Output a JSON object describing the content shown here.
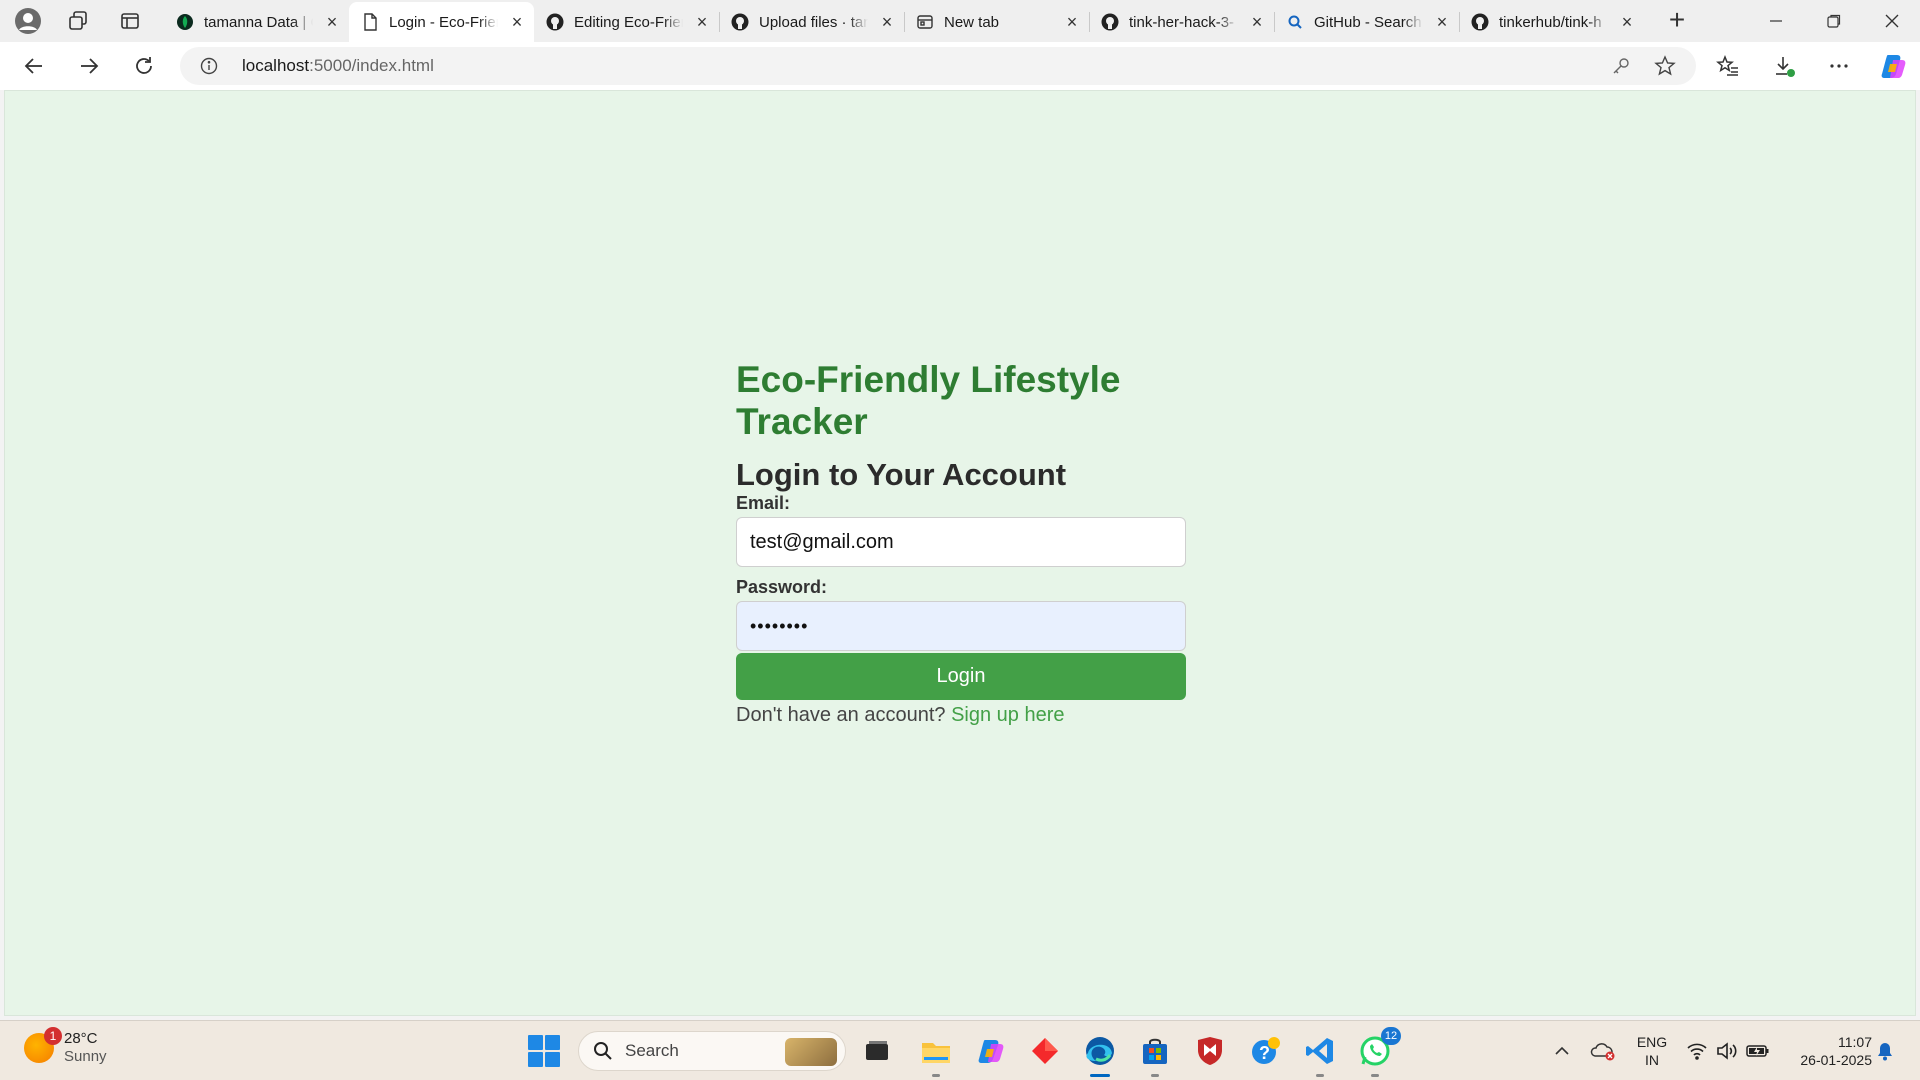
{
  "browser": {
    "tabs": [
      {
        "title": "tamanna Data | C",
        "favicon": "mongodb-leaf-icon",
        "active": false
      },
      {
        "title": "Login - Eco-Frien",
        "favicon": "page-icon",
        "active": true
      },
      {
        "title": "Editing Eco-Frien",
        "favicon": "github-icon",
        "active": false
      },
      {
        "title": "Upload files · tam",
        "favicon": "github-icon",
        "active": false
      },
      {
        "title": "New tab",
        "favicon": "newtab-icon",
        "active": false
      },
      {
        "title": "tink-her-hack-3-",
        "favicon": "github-icon",
        "active": false
      },
      {
        "title": "GitHub - Search",
        "favicon": "search-icon",
        "active": false
      },
      {
        "title": "tinkerhub/tink-h",
        "favicon": "github-icon",
        "active": false
      }
    ],
    "address": {
      "host": "localhost",
      "path": ":5000/index.html"
    }
  },
  "page": {
    "app_title": "Eco-Friendly Lifestyle Tracker",
    "form_title": "Login to Your Account",
    "email_label": "Email:",
    "email_value": "test@gmail.com",
    "password_label": "Password:",
    "password_value": "••••••••",
    "login_button": "Login",
    "signup_prompt": "Don't have an account?",
    "signup_link": "Sign up here",
    "colors": {
      "background": "#e7f5e8",
      "title": "#2e7d32",
      "button": "#43a047"
    }
  },
  "taskbar": {
    "weather": {
      "temp": "28°C",
      "condition": "Sunny",
      "badge": "1"
    },
    "search_placeholder": "Search",
    "whatsapp_badge": "12",
    "lang_line1": "ENG",
    "lang_line2": "IN",
    "time": "11:07",
    "date": "26-01-2025"
  }
}
